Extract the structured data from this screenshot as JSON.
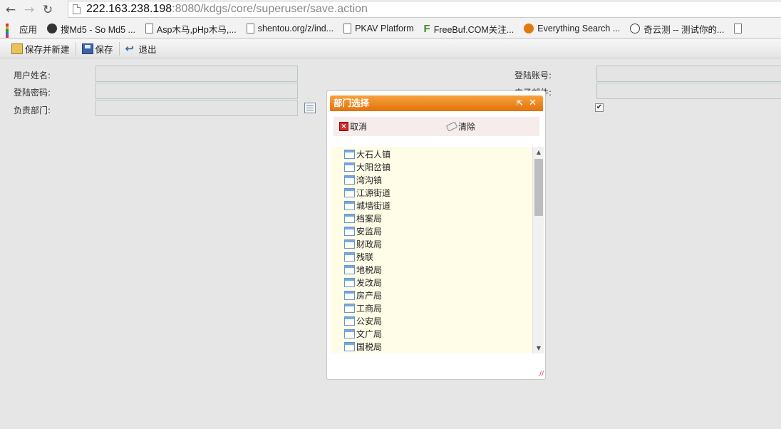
{
  "browser": {
    "url_host": "222.163.238.198",
    "url_path": ":8080/kdgs/core/superuser/save.action",
    "bookmarks": [
      {
        "label": "应用",
        "icon": "apps-grid-icon"
      },
      {
        "label": "搜Md5 - So Md5 ...",
        "icon": "md5-logo-icon"
      },
      {
        "label": "Asp木马,pHp木马,...",
        "icon": "page-icon"
      },
      {
        "label": "shentou.org/z/ind...",
        "icon": "page-icon"
      },
      {
        "label": "PKAV Platform",
        "icon": "page-icon"
      },
      {
        "label": "FreeBuf.COM关注...",
        "icon": "freebuf-f-icon"
      },
      {
        "label": "Everything Search ...",
        "icon": "search-icon"
      },
      {
        "label": "奇云测 -- 测试你的...",
        "icon": "clock-icon"
      }
    ]
  },
  "toolbar": {
    "save_new_label": "保存并新建",
    "save_label": "保存",
    "exit_label": "退出"
  },
  "form": {
    "user_name_label": "用户姓名:",
    "password_label": "登陆密码:",
    "department_label": "负责部门:",
    "login_account_label": "登陆账号:",
    "email_label": "电子邮件:",
    "enabled_checked": true
  },
  "dialog": {
    "title": "部门选择",
    "max_icon": "⇱",
    "close_icon": "✕",
    "cancel_label": "取消",
    "clear_label": "清除",
    "departments": [
      "大石人镇",
      "大阳岔镇",
      "湾沟镇",
      "江源街道",
      "城墙街道",
      "档案局",
      "安监局",
      "财政局",
      "残联",
      "地税局",
      "发改局",
      "房产局",
      "工商局",
      "公安局",
      "文广局",
      "国税局"
    ]
  }
}
